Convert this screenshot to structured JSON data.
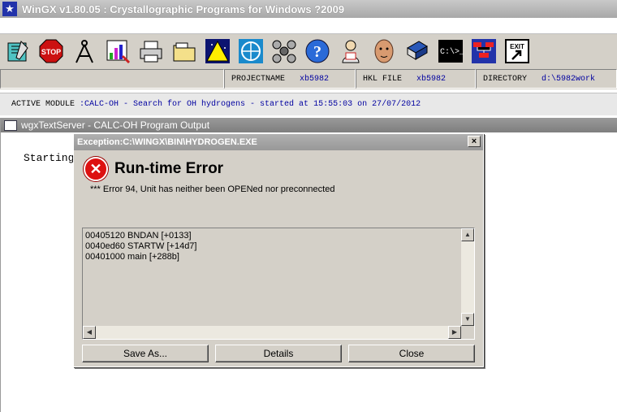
{
  "window": {
    "title": "WinGX v1.80.05  : Crystallographic Programs for Windows ?2009"
  },
  "toolbar": {
    "icons": [
      "notebook-icon",
      "stop-icon",
      "compass-icon",
      "chart-icon",
      "printer-icon",
      "folder-icon",
      "triangle-icon",
      "globe-icon",
      "molecule-icon",
      "help-icon",
      "person-icon",
      "face-icon",
      "book-icon",
      "console-icon",
      "network-icon",
      "exit-icon"
    ],
    "stop_label": "STOP",
    "console_label": "C:\\>_",
    "exit_label": "EXIT"
  },
  "info": {
    "project_label": "PROJECTNAME",
    "project_value": "xb5982",
    "hkl_label": "HKL FILE",
    "hkl_value": "xb5982",
    "dir_label": "DIRECTORY",
    "dir_value": "d:\\5982work"
  },
  "module": {
    "label": "ACTIVE MODULE",
    "value": ":CALC-OH - Search for OH hydrogens - started at 15:55:03 on 27/07/2012"
  },
  "subwindow": {
    "title": "wgxTextServer - CALC-OH Program Output",
    "text": "Starting"
  },
  "dialog": {
    "title": "Exception:C:\\WINGX\\BIN\\HYDROGEN.EXE",
    "close": "×",
    "heading": "Run-time Error",
    "message": "*** Error  94, Unit has neither been OPENed nor preconnected",
    "trace": [
      "00405120 BNDAN [+0133]",
      "0040ed60 STARTW [+14d7]",
      "00401000 main [+288b]"
    ],
    "buttons": {
      "save": "Save As...",
      "details": "Details",
      "close": "Close"
    }
  },
  "colors": {
    "accent": "#0000a0",
    "error": "#dd1111"
  }
}
